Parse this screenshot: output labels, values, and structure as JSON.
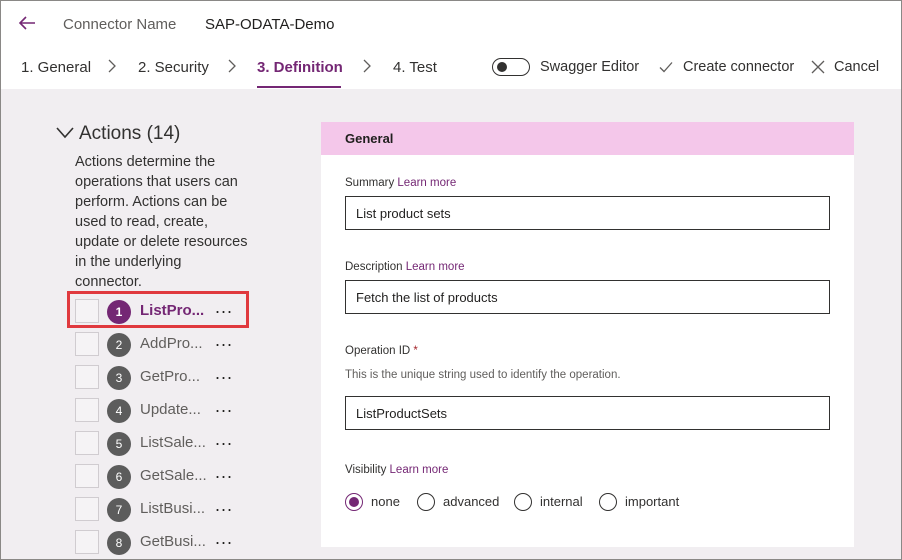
{
  "header": {
    "connector_label": "Connector Name",
    "connector_name": "SAP-ODATA-Demo"
  },
  "steps": [
    {
      "label": "1. General"
    },
    {
      "label": "2. Security"
    },
    {
      "label": "3. Definition",
      "active": true
    },
    {
      "label": "4. Test"
    }
  ],
  "toolbar": {
    "swagger_label": "Swagger Editor",
    "swagger_on": false,
    "create_label": "Create connector",
    "cancel_label": "Cancel"
  },
  "actions": {
    "heading": "Actions (14)",
    "description": "Actions determine the operations that users can perform. Actions can be used to read, create, update or delete resources in the underlying connector.",
    "items": [
      {
        "num": "1",
        "label": "ListPro...",
        "active": true
      },
      {
        "num": "2",
        "label": "AddPro..."
      },
      {
        "num": "3",
        "label": "GetPro..."
      },
      {
        "num": "4",
        "label": "Update..."
      },
      {
        "num": "5",
        "label": "ListSale..."
      },
      {
        "num": "6",
        "label": "GetSale..."
      },
      {
        "num": "7",
        "label": "ListBusi..."
      },
      {
        "num": "8",
        "label": "GetBusi..."
      }
    ],
    "more_glyph": "..."
  },
  "general": {
    "title": "General",
    "summary_label": "Summary",
    "summary_learn": "Learn more",
    "summary_value": "List product sets",
    "description_label": "Description",
    "description_learn": "Learn more",
    "description_value": "Fetch the list of products",
    "opid_label": "Operation ID",
    "opid_required": "*",
    "opid_hint": "This is the unique string used to identify the operation.",
    "opid_value": "ListProductSets",
    "visibility_label": "Visibility",
    "visibility_learn": "Learn more",
    "visibility_options": [
      "none",
      "advanced",
      "internal",
      "important"
    ],
    "visibility_selected": "none"
  },
  "colors": {
    "accent": "#742774",
    "panel_header": "#f4c7ea",
    "content_bg": "#f1eef1",
    "highlight": "#e0393e"
  }
}
